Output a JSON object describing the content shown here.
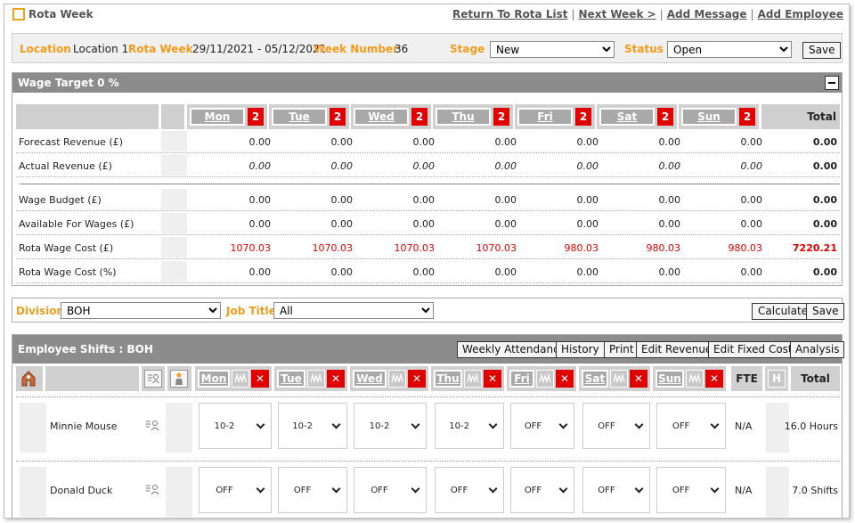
{
  "header": {
    "title": "Rota Week",
    "links": [
      "Return To Rota List",
      "Next Week >",
      "Add Message",
      "Add Employee"
    ]
  },
  "info": {
    "location_label": "Location",
    "location_value": "Location 1",
    "rotaweek_label": "Rota Week",
    "rotaweek_value": "29/11/2021 - 05/12/2021",
    "weeknum_label": "Week Number",
    "weeknum_value": "36",
    "stage_label": "Stage",
    "stage_value": "New",
    "status_label": "Status",
    "status_value": "Open",
    "save_label": "Save"
  },
  "wage": {
    "title": "Wage Target 0 %",
    "days": [
      {
        "label": "Mon",
        "badge": "2"
      },
      {
        "label": "Tue",
        "badge": "2"
      },
      {
        "label": "Wed",
        "badge": "2"
      },
      {
        "label": "Thu",
        "badge": "2"
      },
      {
        "label": "Fri",
        "badge": "2"
      },
      {
        "label": "Sat",
        "badge": "2"
      },
      {
        "label": "Sun",
        "badge": "2"
      }
    ],
    "total_label": "Total",
    "rows": [
      {
        "label": "Forecast Revenue (£)",
        "values": [
          "0.00",
          "0.00",
          "0.00",
          "0.00",
          "0.00",
          "0.00",
          "0.00"
        ],
        "total": "0.00"
      },
      {
        "label": "Actual Revenue (£)",
        "values": [
          "0.00",
          "0.00",
          "0.00",
          "0.00",
          "0.00",
          "0.00",
          "0.00"
        ],
        "total": "0.00"
      },
      {
        "label": "Wage Budget (£)",
        "values": [
          "0.00",
          "0.00",
          "0.00",
          "0.00",
          "0.00",
          "0.00",
          "0.00"
        ],
        "total": "0.00"
      },
      {
        "label": "Available For Wages (£)",
        "values": [
          "0.00",
          "0.00",
          "0.00",
          "0.00",
          "0.00",
          "0.00",
          "0.00"
        ],
        "total": "0.00"
      },
      {
        "label": "Rota Wage Cost (£)",
        "values": [
          "1070.03",
          "1070.03",
          "1070.03",
          "1070.03",
          "980.03",
          "980.03",
          "980.03"
        ],
        "total": "7220.21"
      },
      {
        "label": "Rota Wage Cost (%)",
        "values": [
          "0.00",
          "0.00",
          "0.00",
          "0.00",
          "0.00",
          "0.00",
          "0.00"
        ],
        "total": "0.00"
      }
    ]
  },
  "division": {
    "division_label": "Division",
    "division_value": "BOH",
    "jobtitle_label": "Job Title",
    "jobtitle_value": "All",
    "calculate_label": "Calculate",
    "save_label": "Save"
  },
  "shifts": {
    "title": "Employee Shifts : BOH",
    "buttons": [
      "Weekly Attendance",
      "History",
      "Print",
      "Edit Revenue",
      "Edit Fixed Costs",
      "Analysis"
    ],
    "days": [
      "Mon",
      "Tue",
      "Wed",
      "Thu",
      "Fri",
      "Sat",
      "Sun"
    ],
    "fte_label": "FTE",
    "h_label": "H",
    "total_label": "Total",
    "employees": [
      {
        "name": "Minnie Mouse",
        "shifts": [
          "10-2",
          "10-2",
          "10-2",
          "10-2",
          "OFF",
          "OFF",
          "OFF"
        ],
        "fte": "N/A",
        "total": "16.0 Hours"
      },
      {
        "name": "Donald Duck",
        "shifts": [
          "OFF",
          "OFF",
          "OFF",
          "OFF",
          "OFF",
          "OFF",
          "OFF"
        ],
        "fte": "N/A",
        "total": "7.0 Shifts"
      }
    ]
  },
  "colors": {
    "accent": "#f39b1a",
    "header_gray": "#8c8c8c",
    "alert_red": "#e00000"
  }
}
